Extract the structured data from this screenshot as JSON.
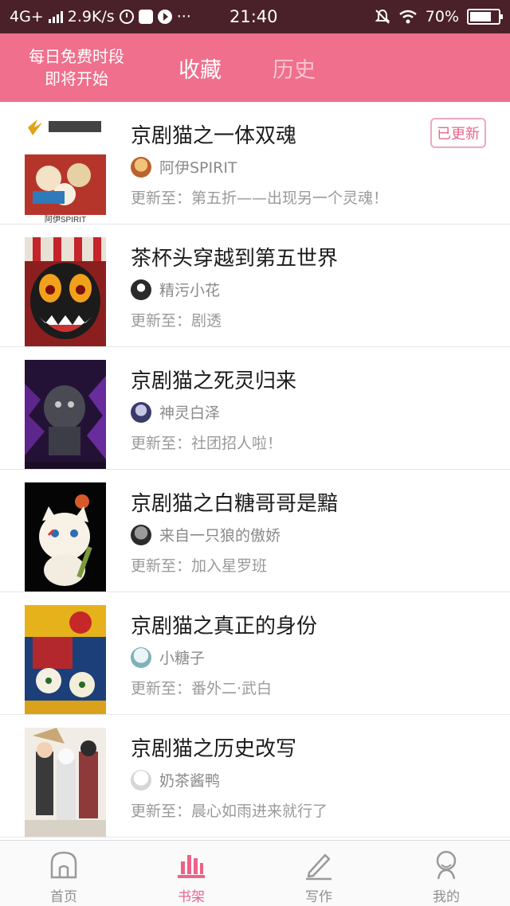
{
  "status_bar": {
    "network": "4G+",
    "speed": "2.9K/s",
    "dots": "···",
    "time": "21:40",
    "battery": "70%"
  },
  "header": {
    "free_line1": "每日免费时段",
    "free_line2": "即将开始",
    "tabs": [
      {
        "label": "收藏"
      },
      {
        "label": "历史"
      }
    ]
  },
  "list": [
    {
      "title": "京剧猫之一体双魂",
      "author": "阿伊SPIRIT",
      "update_prefix": "更新至：",
      "update": "第五折——出现另一个灵魂！",
      "badge": "已更新",
      "cover_text": "阿伊SPIRIT"
    },
    {
      "title": "茶杯头穿越到第五世界",
      "author": "精污小花",
      "update_prefix": "更新至：",
      "update": "剧透"
    },
    {
      "title": "京剧猫之死灵归来",
      "author": "神灵白泽",
      "update_prefix": "更新至：",
      "update": "社团招人啦！"
    },
    {
      "title": "京剧猫之白糖哥哥是黯",
      "author": "来自一只狼的傲娇",
      "update_prefix": "更新至：",
      "update": "加入星罗班"
    },
    {
      "title": "京剧猫之真正的身份",
      "author": "小糖子",
      "update_prefix": "更新至：",
      "update": "番外二·武白"
    },
    {
      "title": "京剧猫之历史改写",
      "author": "奶茶酱鸭",
      "update_prefix": "更新至：",
      "update": "晨心如雨进来就行了"
    }
  ],
  "bottom_nav": [
    {
      "label": "首页",
      "icon": "home-icon"
    },
    {
      "label": "书架",
      "icon": "bookshelf-icon"
    },
    {
      "label": "写作",
      "icon": "pen-icon"
    },
    {
      "label": "我的",
      "icon": "profile-icon"
    }
  ],
  "colors": {
    "status_bar": "#4a2129",
    "header": "#ef6f8d",
    "accent": "#ec6288"
  }
}
